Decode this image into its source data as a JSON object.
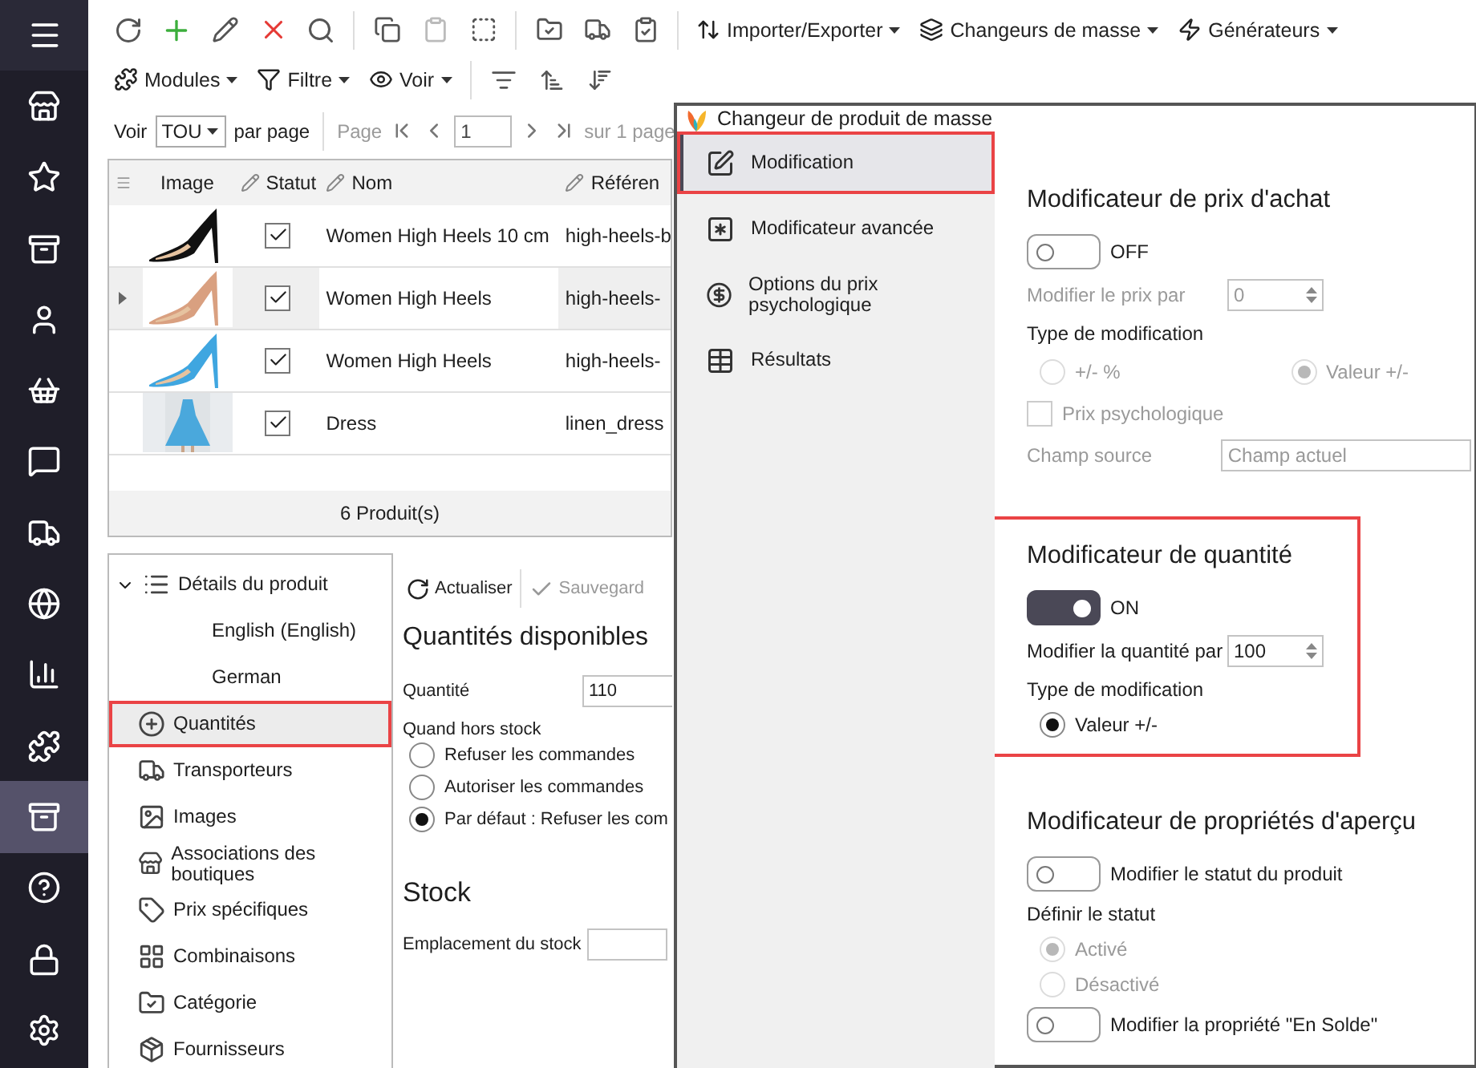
{
  "sidebar": {
    "items": [
      {
        "selected": false
      },
      {
        "selected": false
      },
      {
        "selected": false
      },
      {
        "selected": false
      },
      {
        "selected": false
      },
      {
        "selected": false
      },
      {
        "selected": false
      },
      {
        "selected": false
      },
      {
        "selected": false
      },
      {
        "selected": false
      },
      {
        "selected": true
      },
      {
        "selected": false
      },
      {
        "selected": false
      },
      {
        "selected": false
      }
    ]
  },
  "toolbar": {
    "menus": [
      {
        "label": "Importer/Exporter"
      },
      {
        "label": "Changeurs de masse"
      },
      {
        "label": "Générateurs"
      }
    ],
    "menus_row2": [
      {
        "label": "Modules"
      },
      {
        "label": "Filtre"
      },
      {
        "label": "Voir"
      }
    ]
  },
  "pager": {
    "show_label": "Voir",
    "page_size": "TOU",
    "per_page_label": "par page",
    "page_label": "Page",
    "page": "1",
    "total_label": "sur 1 page"
  },
  "grid": {
    "columns": [
      {
        "label": "Image",
        "editable": false
      },
      {
        "label": "Statut",
        "editable": true
      },
      {
        "label": "Nom",
        "editable": true
      },
      {
        "label": "Référen",
        "editable": true
      }
    ],
    "rows": [
      {
        "checked": true,
        "name": "Women High Heels 10 cm",
        "reference": "high-heels-b",
        "selected": false
      },
      {
        "checked": true,
        "name": "Women High Heels",
        "reference": "high-heels-",
        "selected": true
      },
      {
        "checked": true,
        "name": "Women High Heels",
        "reference": "high-heels-",
        "selected": false
      },
      {
        "checked": true,
        "name": "Dress",
        "reference": "linen_dress",
        "selected": false
      }
    ],
    "footer": "6 Produit(s)"
  },
  "details": {
    "tree": [
      {
        "label": "Détails du produit",
        "selected": false,
        "highlighted": false,
        "expanded": true,
        "children": [
          {
            "label": "English (English)",
            "selected": false,
            "highlighted": false
          },
          {
            "label": "German",
            "selected": false,
            "highlighted": false
          }
        ]
      },
      {
        "label": "Quantités",
        "selected": true,
        "highlighted": true
      },
      {
        "label": "Transporteurs",
        "selected": false,
        "highlighted": false
      },
      {
        "label": "Images",
        "selected": false,
        "highlighted": false
      },
      {
        "label": "Associations des boutiques",
        "selected": false,
        "highlighted": false
      },
      {
        "label": "Prix spécifiques",
        "selected": false,
        "highlighted": false
      },
      {
        "label": "Combinaisons",
        "selected": false,
        "highlighted": false
      },
      {
        "label": "Catégorie",
        "selected": false,
        "highlighted": false
      },
      {
        "label": "Fournisseurs",
        "selected": false,
        "highlighted": false
      }
    ],
    "actions": [
      {
        "label": "Actualiser",
        "disabled": false
      },
      {
        "label": "Sauvegard",
        "disabled": true
      }
    ],
    "heading": "Quantités disponibles",
    "quantity_label": "Quantité",
    "quantity": "110",
    "out_of_stock_label": "Quand hors stock",
    "out_of_stock_options": [
      {
        "label": "Refuser les commandes",
        "selected": false
      },
      {
        "label": "Autoriser les commandes",
        "selected": false
      },
      {
        "label": "Par défaut : Refuser les com",
        "selected": true
      }
    ],
    "stock_heading": "Stock",
    "location_label": "Emplacement du stock"
  },
  "dialog": {
    "title": "Changeur de produit de masse",
    "nav": [
      {
        "label": "Modification",
        "selected": true,
        "highlighted": true
      },
      {
        "label": "Modificateur avancée",
        "selected": false,
        "highlighted": false
      },
      {
        "label": "Options du prix psychologique",
        "selected": false,
        "highlighted": false
      },
      {
        "label": "Résultats",
        "selected": false,
        "highlighted": false
      }
    ],
    "sections": [
      {
        "title": "Modificateur de prix d'achat",
        "highlighted": false,
        "rows": [
          {
            "kind": "toggle",
            "on": false,
            "label": "OFF",
            "disabled": false
          },
          {
            "kind": "spin",
            "label": "Modifier le prix par",
            "value": "0",
            "disabled": true
          },
          {
            "kind": "caption",
            "label": "Type de modification",
            "disabled": false
          },
          {
            "kind": "radio_row",
            "options": [
              {
                "label": "+/- %",
                "selected": false,
                "disabled": true
              },
              {
                "label": "Valeur +/-",
                "selected": true,
                "disabled": true
              }
            ]
          },
          {
            "kind": "checkbox",
            "label": "Prix psychologique",
            "checked": false,
            "disabled": true
          },
          {
            "kind": "select",
            "label": "Champ source",
            "value": "Champ actuel",
            "disabled": true
          }
        ]
      },
      {
        "title": "Modificateur de quantité",
        "highlighted": true,
        "rows": [
          {
            "kind": "toggle",
            "on": true,
            "label": "ON",
            "disabled": false
          },
          {
            "kind": "spin",
            "label": "Modifier la quantité par",
            "value": "100",
            "disabled": false
          },
          {
            "kind": "caption",
            "label": "Type de modification",
            "disabled": false
          },
          {
            "kind": "radio_list",
            "options": [
              {
                "label": "Valeur +/-",
                "selected": true,
                "disabled": false
              }
            ]
          }
        ]
      },
      {
        "title": "Modificateur de propriétés d'aperçu",
        "highlighted": false,
        "rows": [
          {
            "kind": "toggle",
            "on": false,
            "label": "Modifier le statut du produit",
            "disabled": false
          },
          {
            "kind": "caption",
            "label": "Définir le statut",
            "disabled": false
          },
          {
            "kind": "radio_list",
            "options": [
              {
                "label": "Activé",
                "selected": true,
                "disabled": true
              },
              {
                "label": "Désactivé",
                "selected": false,
                "disabled": true
              }
            ]
          },
          {
            "kind": "toggle",
            "on": false,
            "label": "Modifier la propriété \"En Solde\"",
            "disabled": false
          }
        ]
      }
    ]
  }
}
